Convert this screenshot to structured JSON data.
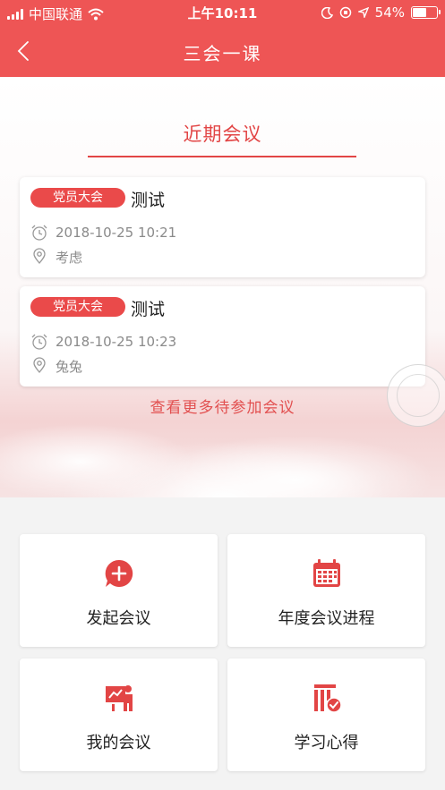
{
  "status_bar": {
    "carrier": "中国联通",
    "time": "上午10:11",
    "battery": "54%",
    "battery_level": 0.54
  },
  "nav": {
    "title": "三会一课",
    "back_icon": "chevron-left-icon"
  },
  "recent": {
    "title": "近期会议",
    "meetings": [
      {
        "type": "党员大会",
        "name": "测试",
        "datetime": "2018-10-25 10:21",
        "location": "考虑"
      },
      {
        "type": "党员大会",
        "name": "测试",
        "datetime": "2018-10-25 10:23",
        "location": "兔兔"
      }
    ],
    "more_link": "查看更多待参加会议"
  },
  "functions": [
    {
      "label": "发起会议",
      "icon": "add-chat-icon"
    },
    {
      "label": "年度会议进程",
      "icon": "calendar-icon"
    },
    {
      "label": "我的会议",
      "icon": "presenter-icon"
    },
    {
      "label": "学习心得",
      "icon": "notes-check-icon"
    }
  ],
  "colors": {
    "brand": "#ee5555",
    "accent_text": "#e24545",
    "badge": "#ea4a4a"
  }
}
